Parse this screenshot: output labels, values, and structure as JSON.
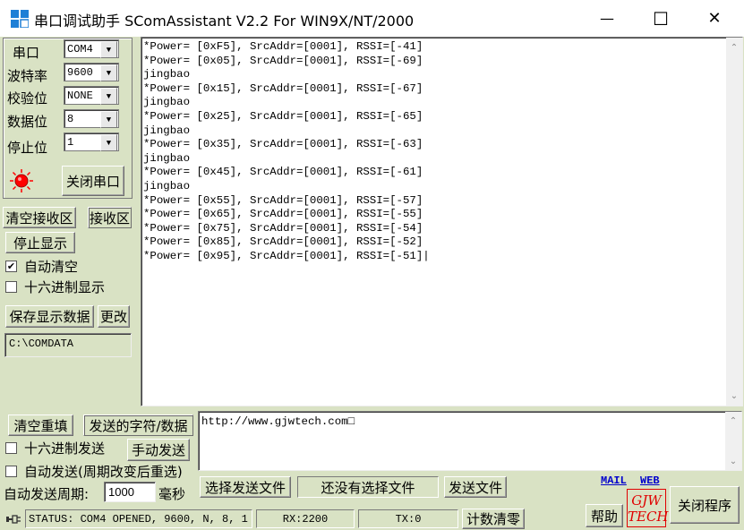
{
  "window": {
    "title": "串口调试助手 SComAssistant V2.2 For WIN9X/NT/2000",
    "minimize_glyph": "—",
    "maximize_glyph": "☐",
    "close_glyph": "✕"
  },
  "settings": {
    "port_label": "串口",
    "port_value": "COM4",
    "baud_label": "波特率",
    "baud_value": "9600",
    "parity_label": "校验位",
    "parity_value": "NONE",
    "databits_label": "数据位",
    "databits_value": "8",
    "stopbits_label": "停止位",
    "stopbits_value": "1",
    "close_port_button": "关闭串口"
  },
  "receive_controls": {
    "clear_recv_button": "清空接收区",
    "recv_area_label": "接收区",
    "stop_display_button": "停止显示",
    "auto_clear_label": "自动清空",
    "auto_clear_checked": true,
    "hex_display_label": "十六进制显示",
    "hex_display_checked": false,
    "save_data_button": "保存显示数据",
    "change_button": "更改",
    "save_path": "C:\\COMDATA"
  },
  "receive_text": "*Power= [0xF5], SrcAddr=[0001], RSSI=[-41]\n*Power= [0x05], SrcAddr=[0001], RSSI=[-69]\njingbao\n*Power= [0x15], SrcAddr=[0001], RSSI=[-67]\njingbao\n*Power= [0x25], SrcAddr=[0001], RSSI=[-65]\njingbao\n*Power= [0x35], SrcAddr=[0001], RSSI=[-63]\njingbao\n*Power= [0x45], SrcAddr=[0001], RSSI=[-61]\njingbao\n*Power= [0x55], SrcAddr=[0001], RSSI=[-57]\n*Power= [0x65], SrcAddr=[0001], RSSI=[-55]\n*Power= [0x75], SrcAddr=[0001], RSSI=[-54]\n*Power= [0x85], SrcAddr=[0001], RSSI=[-52]\n*Power= [0x95], SrcAddr=[0001], RSSI=[-51]|",
  "send_controls": {
    "clear_resend_button": "清空重填",
    "send_chars_label": "发送的字符/数据",
    "hex_send_label": "十六进制发送",
    "hex_send_checked": false,
    "manual_send_button": "手动发送",
    "auto_send_label": "自动发送(周期改变后重选)",
    "auto_send_checked": false,
    "period_label": "自动发送周期:",
    "period_value": "1000",
    "period_unit": "毫秒",
    "send_text": "http://www.gjwtech.com□",
    "select_file_button": "选择发送文件",
    "no_file_text": "还没有选择文件",
    "send_file_button": "发送文件"
  },
  "links": {
    "mail": "MAIL",
    "web": "WEB"
  },
  "logo": {
    "line1": "GJW",
    "line2": "TECH"
  },
  "help_button": "帮助",
  "exit_button": "关闭程序",
  "status": {
    "status_text": "STATUS: COM4 OPENED, 9600, N, 8, 1",
    "rx_text": "RX:2200",
    "tx_text": "TX:0",
    "reset_count_button": "计数清零"
  },
  "colors": {
    "panel_bg": "#d9e2c4",
    "led_red": "#ff0000",
    "link_blue": "#0000cc",
    "logo_red": "#e00000"
  }
}
